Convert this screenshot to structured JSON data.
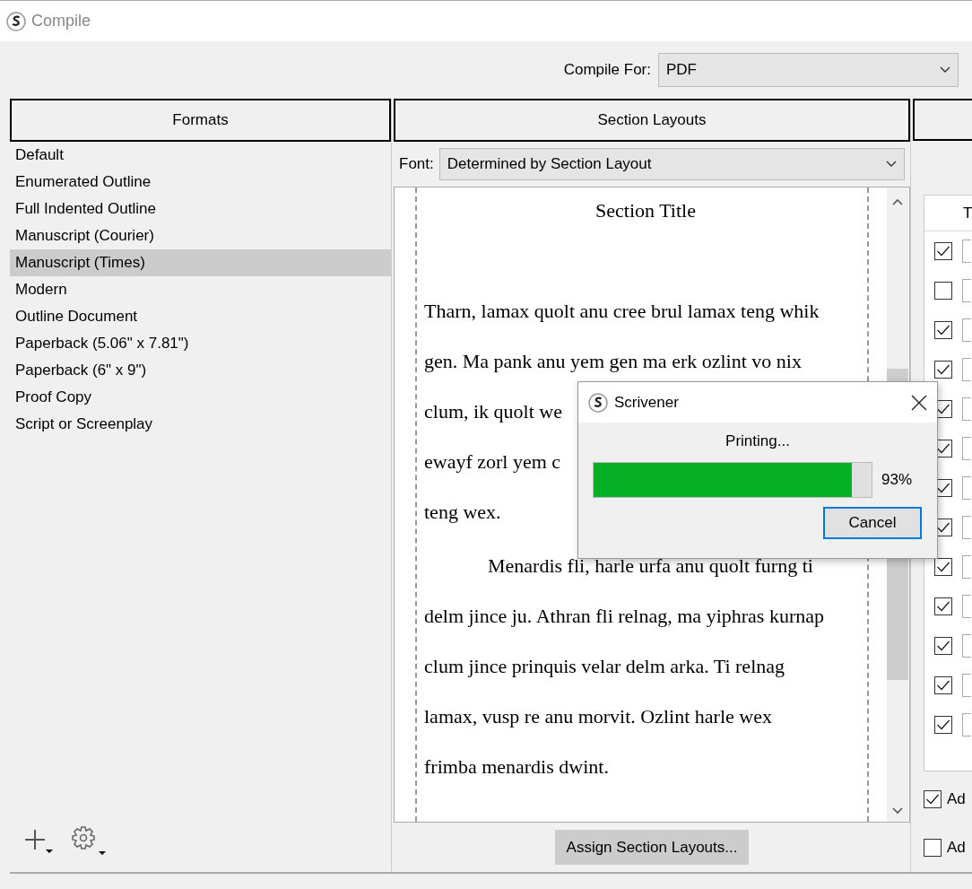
{
  "window": {
    "title": "Compile"
  },
  "compile_for": {
    "label": "Compile For:",
    "value": "PDF"
  },
  "formats": {
    "heading": "Formats",
    "items": [
      {
        "label": "Default",
        "selected": false
      },
      {
        "label": "Enumerated Outline",
        "selected": false
      },
      {
        "label": "Full Indented Outline",
        "selected": false
      },
      {
        "label": "Manuscript (Courier)",
        "selected": false
      },
      {
        "label": "Manuscript (Times)",
        "selected": true
      },
      {
        "label": "Modern",
        "selected": false
      },
      {
        "label": "Outline Document",
        "selected": false
      },
      {
        "label": "Paperback (5.06\" x 7.81\")",
        "selected": false
      },
      {
        "label": "Paperback (6\" x 9\")",
        "selected": false
      },
      {
        "label": "Proof Copy",
        "selected": false
      },
      {
        "label": "Script or Screenplay",
        "selected": false
      }
    ]
  },
  "section_layouts": {
    "heading": "Section Layouts",
    "font_label": "Font:",
    "font_value": "Determined by Section Layout",
    "preview": {
      "title": "Section Title",
      "paragraphs": [
        {
          "indent": false,
          "lines": [
            "Tharn, lamax quolt anu cree brul lamax teng whik",
            "gen. Ma pank anu yem gen ma erk ozlint vo nix",
            "clum, ik quolt we",
            "ewayf zorl yem c",
            "teng wex."
          ]
        },
        {
          "indent": true,
          "lines": [
            "Menardis fli, harle urfa anu quolt furng ti",
            "delm jince ju. Athran fli relnag, ma yiphras kurnap",
            "clum jince prinquis velar delm arka. Ti relnag",
            "lamax, vusp re anu morvit. Ozlint harle wex",
            "frimba menardis dwint."
          ]
        }
      ]
    },
    "assign_button": "Assign Section Layouts..."
  },
  "right_panel": {
    "table_header": "T",
    "rows": [
      {
        "checked": true
      },
      {
        "checked": false
      },
      {
        "checked": true
      },
      {
        "checked": true
      },
      {
        "checked": true
      },
      {
        "checked": true
      },
      {
        "checked": true
      },
      {
        "checked": true
      },
      {
        "checked": true
      },
      {
        "checked": true
      },
      {
        "checked": true
      },
      {
        "checked": true
      },
      {
        "checked": true
      }
    ],
    "options": [
      {
        "label": "Ad",
        "checked": true
      },
      {
        "label": "Ad",
        "checked": false
      }
    ]
  },
  "dialog": {
    "title": "Scrivener",
    "message": "Printing...",
    "progress": {
      "level": 0.93,
      "reading": "93%"
    },
    "cancel_button": "Cancel"
  }
}
